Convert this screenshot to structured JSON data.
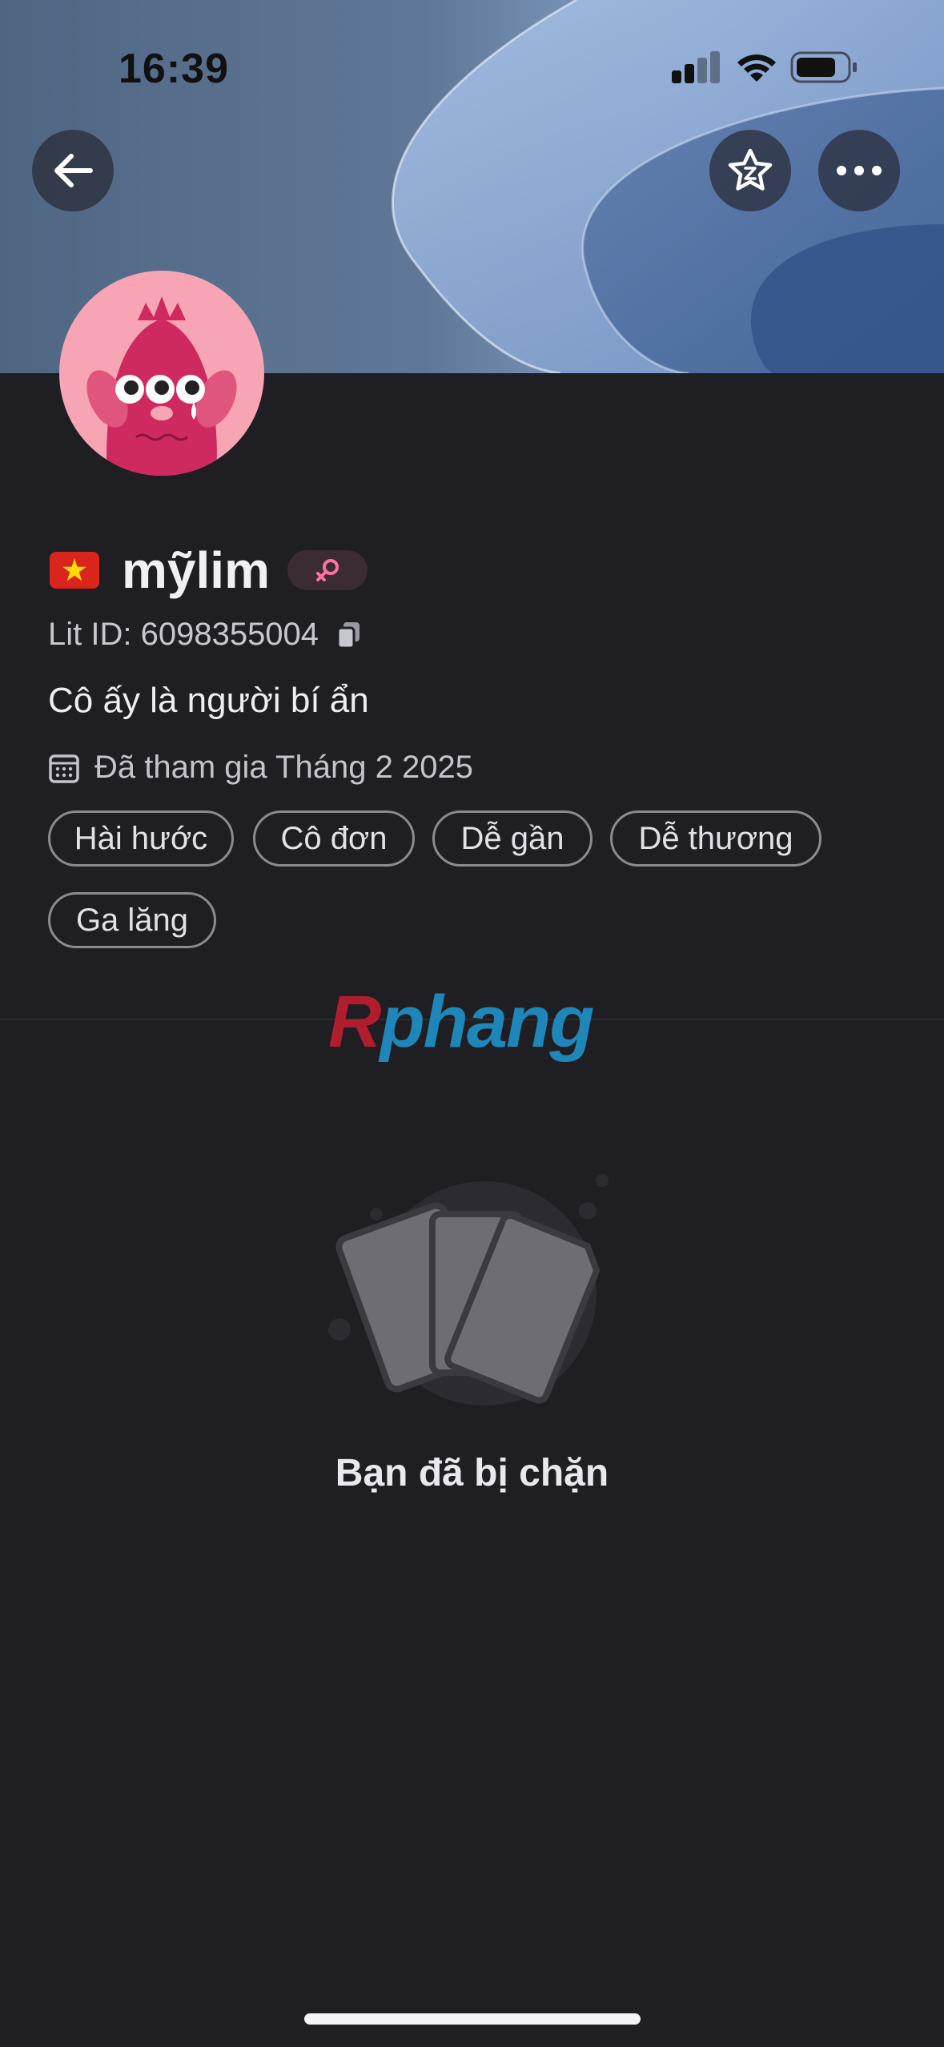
{
  "status_bar": {
    "time": "16:39"
  },
  "profile": {
    "username": "mỹlim",
    "lit_id": "Lit ID: 6098355004",
    "bio": "Cô ấy là người bí ẩn",
    "joined": "Đã tham gia Tháng 2 2025"
  },
  "tags": [
    "Hài hước",
    "Cô đơn",
    "Dễ gần",
    "Dễ thương",
    "Ga lăng"
  ],
  "watermark": {
    "first": "R",
    "rest": "phang"
  },
  "blocked_message": "Bạn đã bị chặn",
  "colors": {
    "background": "#1f1e23",
    "flag_red": "#da251d",
    "flag_star": "#ffde00",
    "avatar_bg": "#f7a5b4",
    "gender_pink": "#ff6fa5"
  }
}
